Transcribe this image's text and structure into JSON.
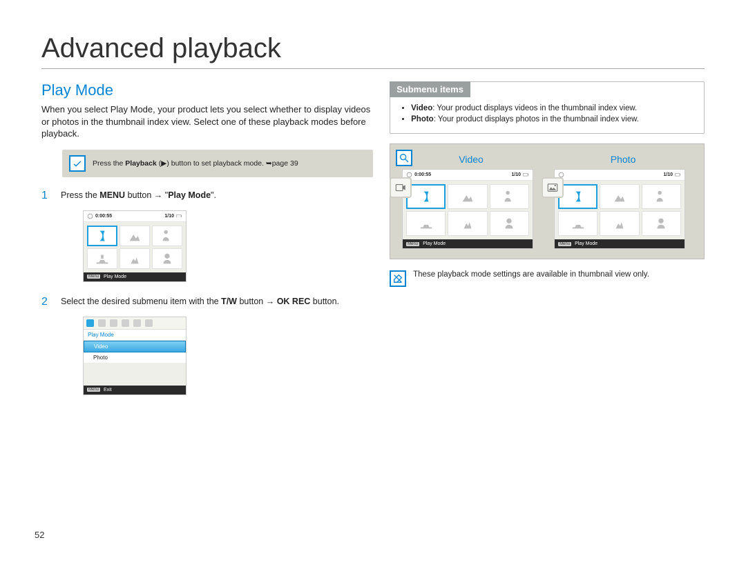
{
  "page_number": "52",
  "main_title": "Advanced playback",
  "section_title": "Play Mode",
  "intro": "When you select Play Mode, your product lets you select whether to display videos or photos in the thumbnail index view. Select one of these playback modes before playback.",
  "precheck": {
    "prefix": "Press the ",
    "bold1": "Playback",
    "mid": " (▶) button to set playback mode. ➥",
    "page_ref": "page 39"
  },
  "steps": [
    {
      "num": "1",
      "t1": "Press the ",
      "b1": "MENU",
      "t2": " button → \"",
      "b2": "Play Mode",
      "t3": "\"."
    },
    {
      "num": "2",
      "t1": "Select the desired submenu item with the ",
      "b1": "T/W",
      "t2": " button → ",
      "b2": "OK REC",
      "t3": " button."
    }
  ],
  "lcd1": {
    "time": "0:00:55",
    "counter": "1/10",
    "footer_tag": "Menu",
    "footer_label": "Play Mode"
  },
  "lcd2": {
    "header": "Play Mode",
    "rows": [
      "Video",
      "Photo"
    ],
    "footer_tag": "Menu",
    "footer_label": "Exit"
  },
  "submenu": {
    "header": "Submenu items",
    "items": [
      {
        "bold": "Video",
        "text": ": Your product displays videos in the thumbnail index view."
      },
      {
        "bold": "Photo",
        "text": ": Your product displays photos in the thumbnail index view."
      }
    ]
  },
  "previews": {
    "video_label": "Video",
    "photo_label": "Photo",
    "time": "0:00:55",
    "counter": "1/10",
    "footer_tag": "Menu",
    "footer_label": "Play Mode"
  },
  "footnote": "These playback mode settings are available in thumbnail view only."
}
